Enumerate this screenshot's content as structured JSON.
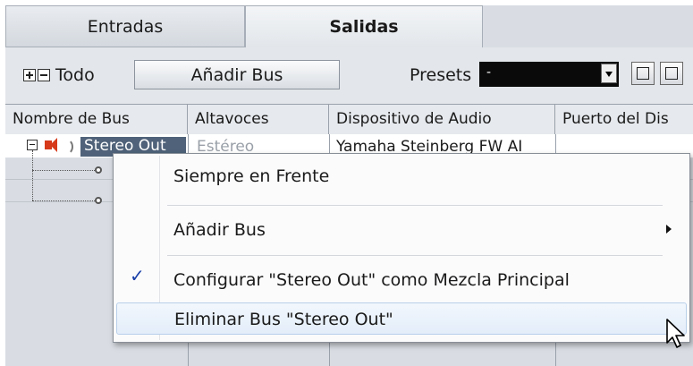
{
  "tabs": [
    {
      "label": "Entradas"
    },
    {
      "label": "Salidas"
    }
  ],
  "toolbar": {
    "todo_label": "Todo",
    "add_bus_label": "Añadir Bus",
    "presets_label": "Presets",
    "presets_value": "-"
  },
  "table": {
    "columns": [
      "Nombre de Bus",
      "Altavoces",
      "Dispositivo de Audio",
      "Puerto del Dis"
    ],
    "row0": {
      "name": "Stereo Out",
      "speakers": "Estéreo",
      "device": "Yamaha Steinberg FW AI"
    }
  },
  "context_menu": {
    "items": [
      {
        "label": "Siempre en Frente"
      },
      {
        "label": "Añadir Bus",
        "submenu": true
      },
      {
        "label": "Configurar \"Stereo Out\" como Mezcla Principal",
        "checked": true,
        "check_mark": "✓"
      },
      {
        "label": "Eliminar Bus \"Stereo Out\"",
        "hovered": true
      }
    ]
  },
  "colors": {
    "selection": "#4f6279",
    "speaker": "#d63a1a",
    "check": "#1a3fa8"
  }
}
